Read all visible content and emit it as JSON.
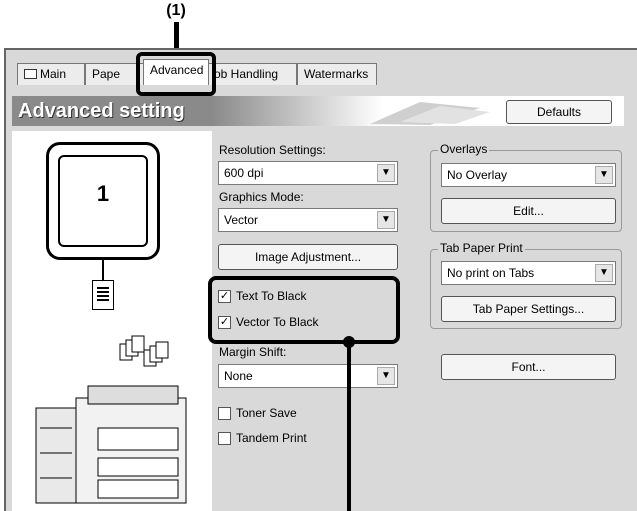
{
  "callout": {
    "top_label": "(1)"
  },
  "tabs": [
    {
      "label": "Main"
    },
    {
      "label": "Pape"
    },
    {
      "label": "Advanced"
    },
    {
      "label": "ob Handling"
    },
    {
      "label": "Watermarks"
    }
  ],
  "banner": {
    "title": "Advanced setting",
    "defaults_label": "Defaults"
  },
  "preview": {
    "page_number": "1"
  },
  "resolution": {
    "label": "Resolution Settings:",
    "value": "600 dpi"
  },
  "graphics_mode": {
    "label": "Graphics Mode:",
    "value": "Vector"
  },
  "image_adjustment": {
    "label": "Image Adjustment..."
  },
  "checks": {
    "text_to_black": {
      "label": "Text To Black",
      "checked": true
    },
    "vector_to_black": {
      "label": "Vector To Black",
      "checked": true
    },
    "toner_save": {
      "label": "Toner Save",
      "checked": false
    },
    "tandem_print": {
      "label": "Tandem Print",
      "checked": false
    }
  },
  "margin_shift": {
    "label": "Margin Shift:",
    "value": "None"
  },
  "overlays": {
    "legend": "Overlays",
    "value": "No Overlay",
    "edit_label": "Edit..."
  },
  "tab_paper": {
    "legend": "Tab Paper Print",
    "value": "No print on Tabs",
    "settings_label": "Tab Paper Settings..."
  },
  "font_button": {
    "label": "Font..."
  },
  "colors": {
    "banner": "#8a8a8a",
    "dialog": "#d9d9d9",
    "highlight": "#000000"
  }
}
